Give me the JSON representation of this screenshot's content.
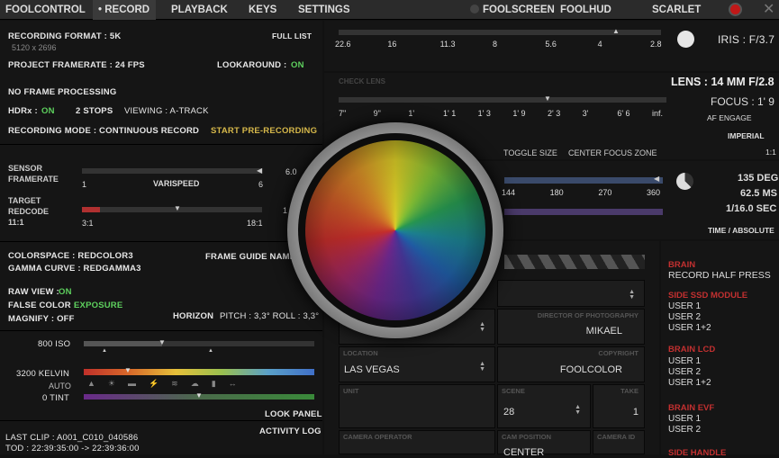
{
  "tabs": {
    "foolcontrol": "FOOLCONTROL",
    "record": "• RECORD",
    "playback": "PLAYBACK",
    "keys": "KEYS",
    "settings": "SETTINGS",
    "foolscreen": "FOOLSCREEN",
    "foolhud": "FOOLHUD",
    "camera": "SCARLET"
  },
  "record": {
    "format": "RECORDING FORMAT : 5K",
    "format_res": "5120 x 2696",
    "full_list": "FULL LIST",
    "project_framerate": "PROJECT FRAMERATE : 24 FPS",
    "lookaround_label": "LOOKAROUND :",
    "lookaround_value": "ON",
    "no_processing": "NO FRAME PROCESSING",
    "hdrx_label": "HDRx :",
    "hdrx_value": "ON",
    "stops": "2 STOPS",
    "viewing": "VIEWING : A-TRACK",
    "mode": "RECORDING MODE : CONTINUOUS RECORD",
    "prerecord": "START PRE-RECORDING"
  },
  "sensor": {
    "label_a": "SENSOR",
    "label_b": "FRAMERATE",
    "min": "1",
    "mid": "VARISPEED",
    "max": "6",
    "side": "6.0",
    "target_a": "TARGET",
    "target_b": "REDCODE",
    "target_c": "11:1",
    "rc_min": "3:1",
    "rc_max": "18:1",
    "rc_side": "1"
  },
  "color": {
    "colorspace": "COLORSPACE : REDCOLOR3",
    "gamma": "GAMMA CURVE  : REDGAMMA3",
    "frame_guide": "FRAME GUIDE NAME",
    "raw_label": "RAW VIEW :",
    "raw_value": "ON",
    "false_label": "FALSE COLOR :",
    "false_value": "EXPOSURE",
    "magnify": "MAGNIFY : OFF",
    "horizon": "HORIZON",
    "pitch": "PITCH : 3,3° ROLL : 3,3°"
  },
  "exposure": {
    "iso": "800 ISO",
    "kelvin": "3200 KELVIN",
    "auto": "AUTO",
    "tint": "0 TINT",
    "look_panel": "LOOK PANEL",
    "iso_level": 0.34,
    "kelvin_level": 0.2,
    "tint_level": 0.5
  },
  "clip": {
    "last": "LAST CLIP : A001_C010_040586",
    "tod": "TOD : 22:39:35:00 -> 22:39:36:00",
    "activity_log": "ACTIVITY LOG"
  },
  "iris": {
    "ticks": [
      "22.6",
      "16",
      "11.3",
      "8",
      "5.6",
      "4",
      "2.8"
    ],
    "label": "IRIS : F/3.7",
    "level": 0.8
  },
  "lens": {
    "check": "CHECK LENS",
    "lens_label": "LENS : 14 MM F/2.8",
    "focus_label": "FOCUS : 1' 9",
    "af": "AF ENGAGE",
    "imperial": "IMPERIAL",
    "ratio": "1:1",
    "focus_ticks": [
      "7\"",
      "9\"",
      "1'",
      "1' 1",
      "1' 3",
      "1' 9",
      "2' 3",
      "3'",
      "6' 6",
      "inf."
    ],
    "toggle_size": "TOGGLE SIZE",
    "center_focus": "CENTER FOCUS ZONE",
    "focus_level": 0.62
  },
  "shutter": {
    "ticks": [
      "144",
      "180",
      "270",
      "360"
    ],
    "deg": "135 DEG",
    "ms": "62.5 MS",
    "sec": "1/16.0 SEC",
    "mode": "TIME / ABSOLUTE",
    "level": 0.92
  },
  "meta": {
    "director_cap": "DIRECTOR OF PHOTOGRAPHY",
    "director_val": "MIKAEL",
    "location_cap": "LOCATION",
    "location_val": "LAS VEGAS",
    "copyright_cap": "COPYRIGHT",
    "copyright_val": "FOOLCOLOR",
    "unit_cap": "UNIT",
    "scene_cap": "SCENE",
    "scene_val": "28",
    "take_cap": "TAKE",
    "take_val": "1",
    "operator_cap": "CAMERA OPERATOR",
    "campos_cap": "CAM POSITION",
    "campos_val": "CENTER",
    "camid_cap": "CAMERA ID"
  },
  "brain": {
    "title": "BRAIN",
    "half_press": "RECORD HALF PRESS",
    "ssd_title": "SIDE SSD MODULE",
    "ssd": [
      "USER 1",
      "USER 2",
      "USER 1+2"
    ],
    "lcd_title": "BRAIN LCD",
    "lcd": [
      "USER 1",
      "USER 2",
      "USER 1+2"
    ],
    "evf_title": "BRAIN EVF",
    "evf": [
      "USER 1",
      "USER 2"
    ],
    "handle_title": "SIDE HANDLE"
  }
}
